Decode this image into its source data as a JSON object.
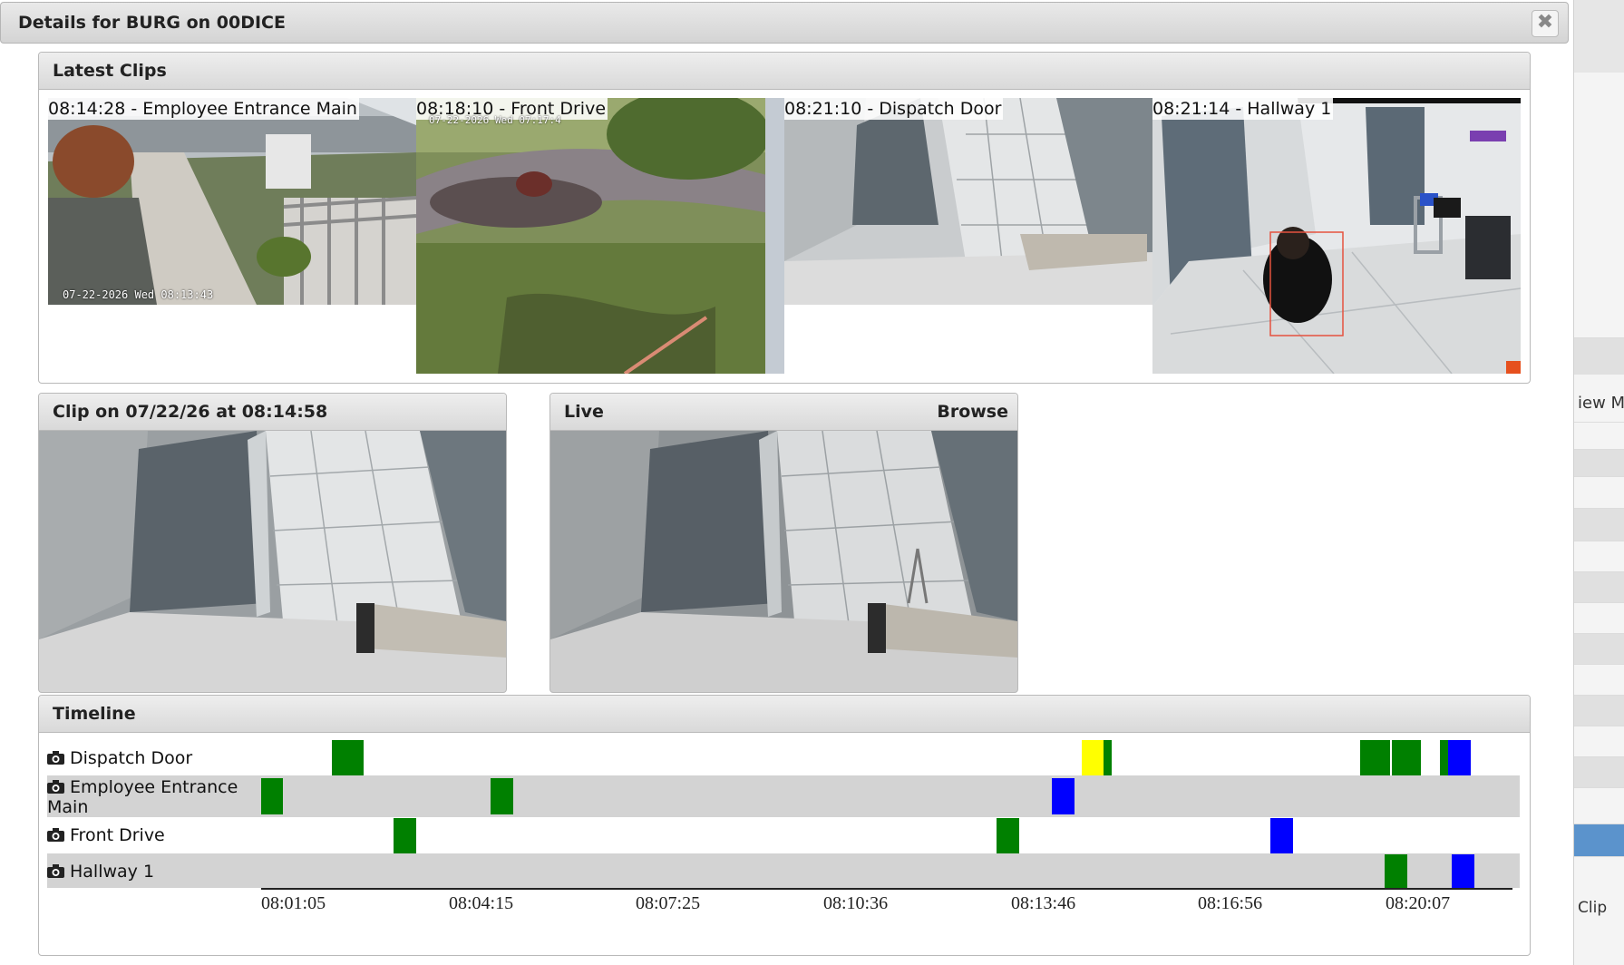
{
  "dialog": {
    "title": "Details for BURG on 00DICE",
    "close_glyph": "✖"
  },
  "latest_clips": {
    "title": "Latest Clips",
    "clips": [
      {
        "label": "08:14:28 - Employee Entrance Main",
        "stamp": "07-22-2026 Wed 08:13:43"
      },
      {
        "label": "08:18:10 - Front Drive",
        "stamp": "07-22-2026 Wed 07:17:4"
      },
      {
        "label": "08:21:10 - Dispatch Door"
      },
      {
        "label": "08:21:14 - Hallway 1"
      }
    ]
  },
  "clip_panel": {
    "title": "Clip on 07/22/26 at 08:14:58"
  },
  "live_panel": {
    "title": "Live",
    "browse": "Browse"
  },
  "timeline": {
    "title": "Timeline",
    "rows": [
      {
        "name": "Dispatch Door"
      },
      {
        "name": "Employee Entrance Main"
      },
      {
        "name": "Front Drive"
      },
      {
        "name": "Hallway 1"
      }
    ],
    "ticks": [
      "08:01:05",
      "08:04:15",
      "08:07:25",
      "08:10:36",
      "08:13:46",
      "08:16:56",
      "08:20:07"
    ],
    "colors": {
      "motion": "#008000",
      "person": "#0000ff",
      "alert": "#ffff00"
    }
  },
  "background_page": {
    "view_text": "iew M",
    "clip_text": "Clip"
  }
}
